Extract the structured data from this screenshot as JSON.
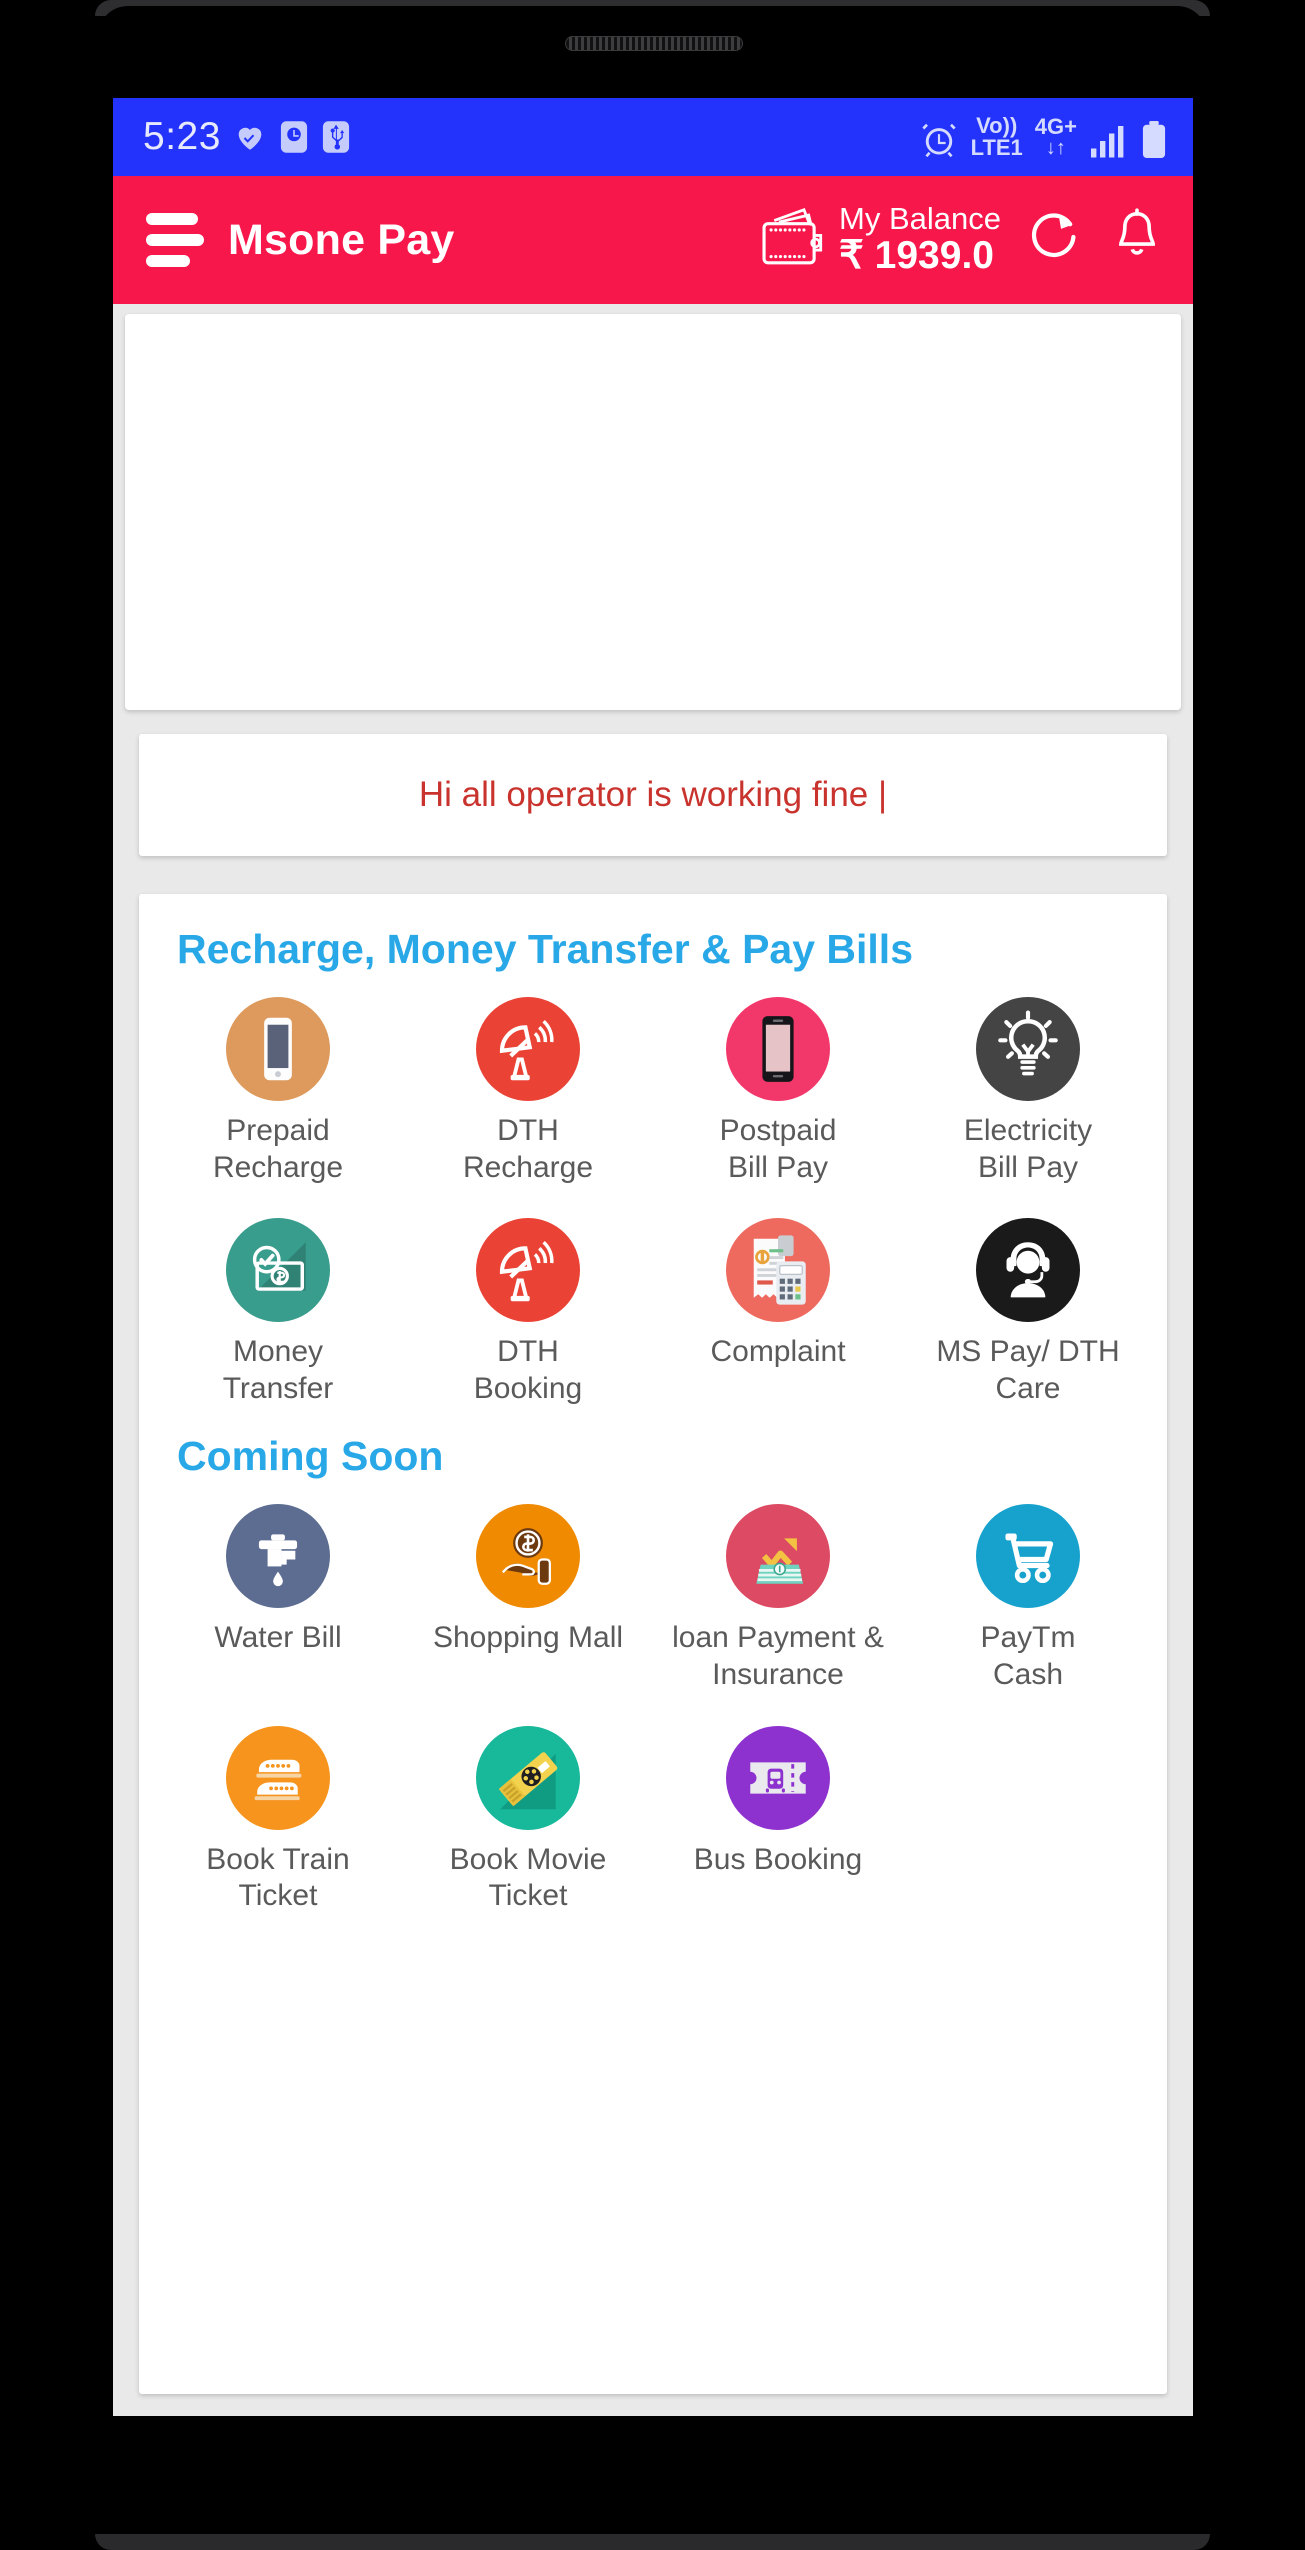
{
  "status_bar": {
    "time": "5:23",
    "left_icons": [
      "heart-icon",
      "alarm-square-icon",
      "usb-icon"
    ],
    "alarm_icon": "alarm-clock-icon",
    "volte_line1": "Vo))",
    "volte_line2": "LTE1",
    "network_type": "4G+",
    "data_arrows": "↓↑",
    "signal_icon": "signal-bars-icon",
    "battery_icon": "battery-icon",
    "background_color": "#2333fc"
  },
  "app_bar": {
    "menu_icon": "hamburger-menu-icon",
    "title": "Msone Pay",
    "wallet_icon": "wallet-icon",
    "balance_label": "My Balance",
    "balance_amount": "₹ 1939.0",
    "refresh_icon": "refresh-icon",
    "notification_icon": "bell-icon",
    "background_color": "#f8174b"
  },
  "banner": {
    "name": "promo-banner",
    "content": ""
  },
  "notice": {
    "text": "Hi all operator is working fine |",
    "color": "#c9332e"
  },
  "services": {
    "title": "Recharge, Money Transfer & Pay Bills",
    "title_color": "#29a8e8",
    "items": [
      {
        "label": "Prepaid\nRecharge",
        "icon": "smartphone-icon",
        "bg": "#dd9a5c"
      },
      {
        "label": "DTH\nRecharge",
        "icon": "satellite-dish-icon",
        "bg": "#ea4335"
      },
      {
        "label": "Postpaid\nBill Pay",
        "icon": "mobile-phone-icon",
        "bg": "#f2386b"
      },
      {
        "label": "Electricity\nBill Pay",
        "icon": "light-bulb-icon",
        "bg": "#444444"
      },
      {
        "label": "Money\nTransfer",
        "icon": "money-check-icon",
        "bg": "#389d8c"
      },
      {
        "label": "DTH\nBooking",
        "icon": "satellite-dish-icon",
        "bg": "#ea4335"
      },
      {
        "label": "Complaint",
        "icon": "invoice-calculator-icon",
        "bg": "#ef6a5e"
      },
      {
        "label": "MS Pay/ DTH\nCare",
        "icon": "headset-support-icon",
        "bg": "#1a1a1a"
      }
    ]
  },
  "coming_soon": {
    "title": "Coming Soon",
    "title_color": "#29a8e8",
    "items": [
      {
        "label": "Water Bill",
        "icon": "water-tap-icon",
        "bg": "#5d6d92"
      },
      {
        "label": "Shopping Mall",
        "icon": "hand-coin-icon",
        "bg": "#f08a00"
      },
      {
        "label": "loan Payment &\nInsurance",
        "icon": "money-growth-icon",
        "bg": "#dd4a63"
      },
      {
        "label": "PayTm\nCash",
        "icon": "shopping-cart-icon",
        "bg": "#17a2cd"
      },
      {
        "label": "Book Train\nTicket",
        "icon": "train-icon",
        "bg": "#f7941d"
      },
      {
        "label": "Book Movie\nTicket",
        "icon": "movie-ticket-icon",
        "bg": "#18b89a"
      },
      {
        "label": "Bus Booking",
        "icon": "bus-ticket-icon",
        "bg": "#8e32cf"
      }
    ]
  },
  "nav_bar": {
    "recents_icon": "recents-icon",
    "home_icon": "home-circle-icon",
    "back_icon": "back-chevron-icon"
  }
}
